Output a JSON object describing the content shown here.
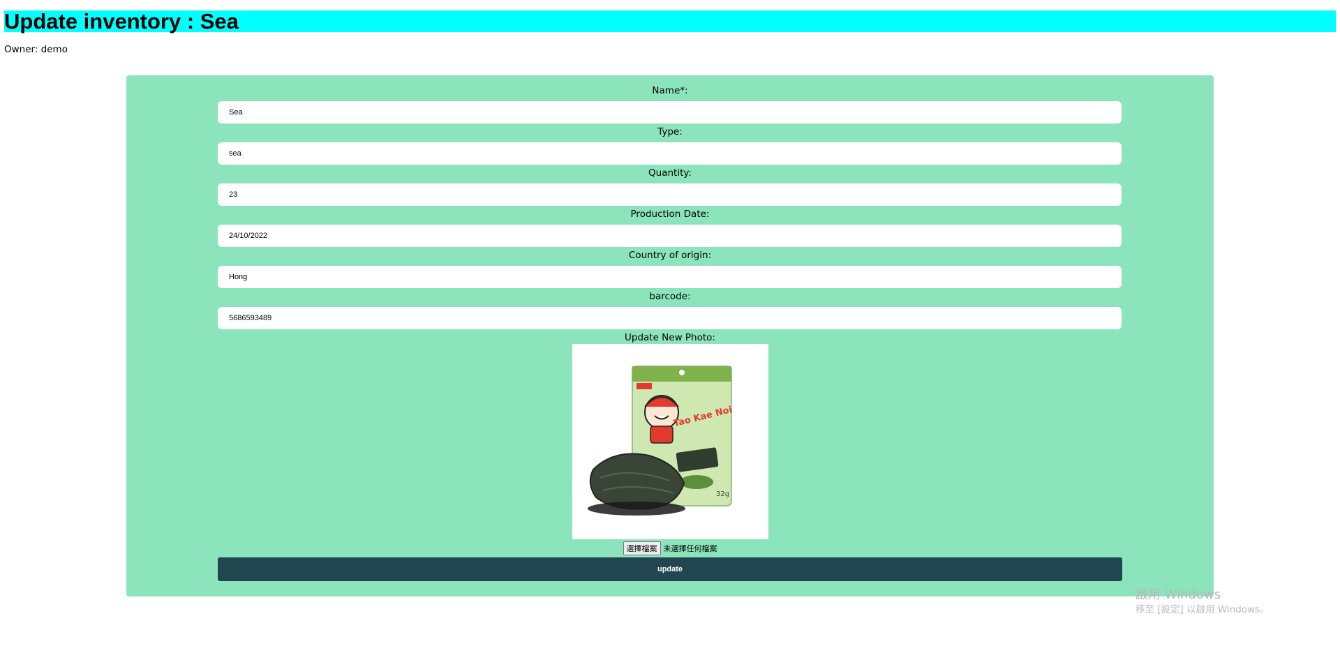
{
  "header": {
    "title": "Update inventory : Sea"
  },
  "owner": {
    "text": "Owner: demo"
  },
  "form": {
    "fields": [
      {
        "label": "Name*:",
        "value": "Sea"
      },
      {
        "label": "Type:",
        "value": "sea"
      },
      {
        "label": "Quantity:",
        "value": "23"
      },
      {
        "label": "Production Date:",
        "value": "24/10/2022"
      },
      {
        "label": "Country of origin:",
        "value": "Hong"
      },
      {
        "label": "barcode:",
        "value": "5686593489"
      }
    ],
    "photo_label": "Update New Photo:",
    "photo_brand": "Tao Kae Noi",
    "file_button": "選擇檔案",
    "file_status": "未選擇任何檔案",
    "submit_label": "update"
  },
  "watermark": {
    "line1": "啟用 Windows",
    "line2": "移至 [設定] 以啟用 Windows。"
  },
  "colors": {
    "title_bg": "#00ffff",
    "panel_bg": "#8ce4bc",
    "button_bg": "#21464f"
  }
}
